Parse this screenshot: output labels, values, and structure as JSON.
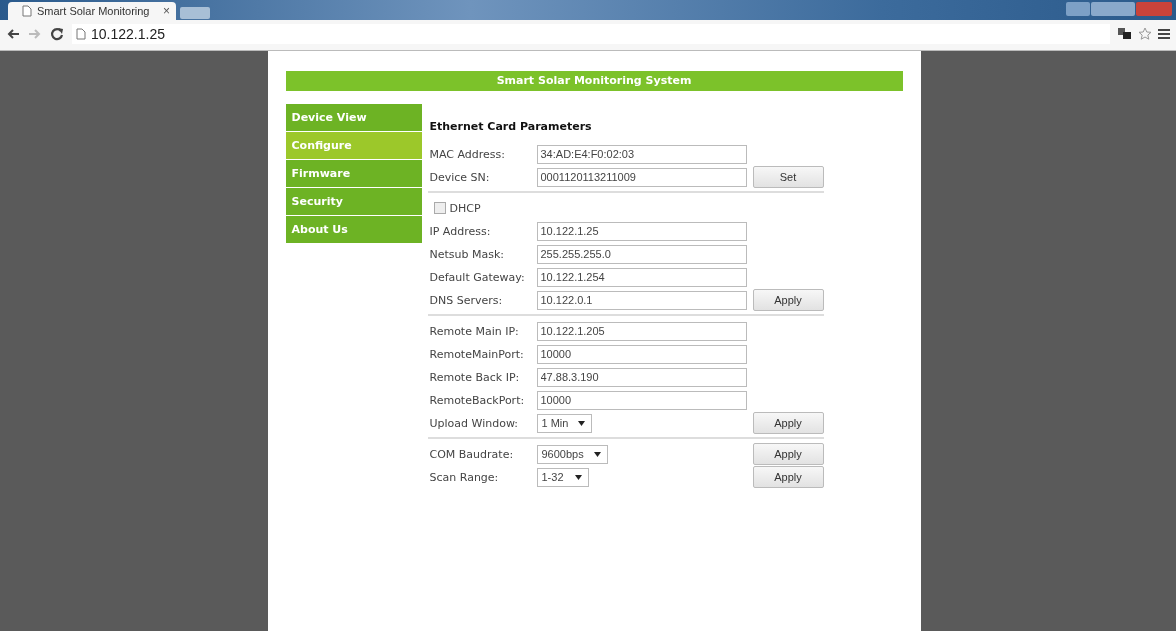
{
  "browser": {
    "tab_title": "Smart Solar Monitoring",
    "tab_close": "×",
    "address": "10.122.1.25"
  },
  "header": {
    "title": "Smart Solar Monitoring System"
  },
  "sidebar": {
    "items": [
      {
        "label": "Device View",
        "selected": false
      },
      {
        "label": "Configure",
        "selected": true
      },
      {
        "label": "Firmware",
        "selected": false
      },
      {
        "label": "Security",
        "selected": false
      },
      {
        "label": "About Us",
        "selected": false
      }
    ]
  },
  "form": {
    "title": "Ethernet Card Parameters",
    "sections": [
      {
        "rows": [
          {
            "kind": "text",
            "label": "MAC Address:",
            "value": "34:AD:E4:F0:02:03"
          },
          {
            "kind": "text",
            "label": "Device SN:",
            "value": "0001120113211009",
            "button": "Set"
          }
        ]
      },
      {
        "rows": [
          {
            "kind": "checkbox",
            "label": "DHCP",
            "checked": false
          },
          {
            "kind": "text",
            "label": "IP Address:",
            "value": "10.122.1.25"
          },
          {
            "kind": "text",
            "label": "Netsub Mask:",
            "value": "255.255.255.0"
          },
          {
            "kind": "text",
            "label": "Default Gateway:",
            "value": "10.122.1.254"
          },
          {
            "kind": "text",
            "label": "DNS Servers:",
            "value": "10.122.0.1",
            "button": "Apply"
          }
        ]
      },
      {
        "rows": [
          {
            "kind": "text",
            "label": "Remote Main IP:",
            "value": "10.122.1.205"
          },
          {
            "kind": "text",
            "label": "RemoteMainPort:",
            "value": "10000"
          },
          {
            "kind": "text",
            "label": "Remote Back IP:",
            "value": "47.88.3.190"
          },
          {
            "kind": "text",
            "label": "RemoteBackPort:",
            "value": "10000"
          },
          {
            "kind": "select",
            "label": "Upload Window:",
            "value": "1 Min",
            "button": "Apply"
          }
        ]
      },
      {
        "rows": [
          {
            "kind": "select",
            "label": "COM Baudrate:",
            "value": "9600bps",
            "button": "Apply"
          },
          {
            "kind": "select",
            "label": "Scan Range:",
            "value": "1-32",
            "button": "Apply"
          }
        ]
      }
    ]
  }
}
